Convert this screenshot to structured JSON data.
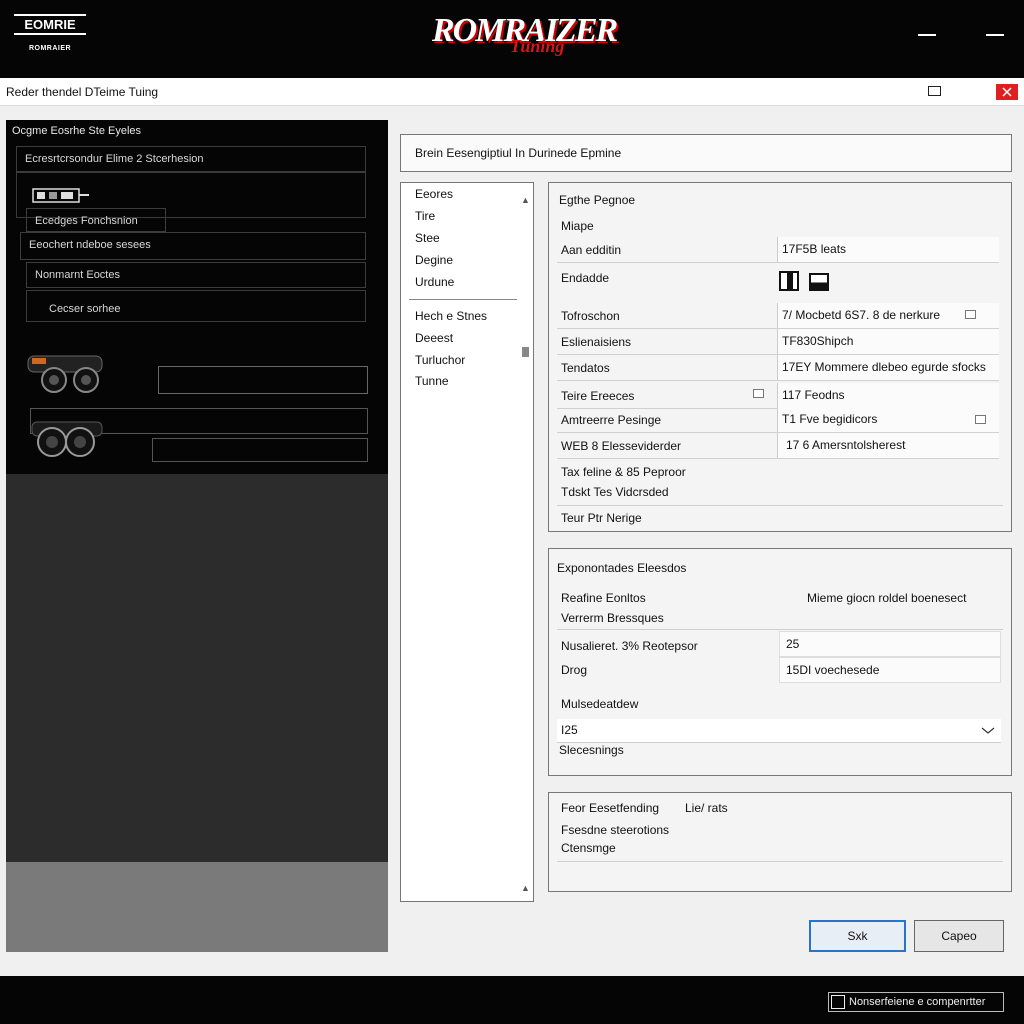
{
  "brand": {
    "left_logo_line1": "EOMRIE",
    "left_logo_line2": "ROMRAIER",
    "center_logo_main": "ROMRAIZER",
    "center_logo_sub": "Tuning"
  },
  "window": {
    "title": "Reder thendel DTeime Tuing"
  },
  "left_panel": {
    "heading": "Ocgme Eosrhe Ste Eyeles",
    "rows": [
      "Ecresrtcrsondur Elime 2 Stcerhesion",
      "Ecedges Fonchsnion",
      "Eeochert ndeboe sesees",
      "Nonmarnt Eoctes",
      "Cecser sorhee"
    ]
  },
  "breadcrumb": {
    "text": "Brein Eesengiptiul In Durinede Epmine"
  },
  "nav": {
    "group1": [
      "Eeores",
      "Tire",
      "Stee",
      "Degine",
      "Urdune"
    ],
    "group2": [
      "Hech e Stnes",
      "Deeest",
      "Turluchor",
      "Tunne"
    ]
  },
  "properties": {
    "header": "Egthe Pegnoe",
    "subheader": "Miape",
    "rows": [
      {
        "label": "Aan edditin",
        "value": "17F5B leats"
      },
      {
        "label": "Endadde",
        "value": ""
      },
      {
        "label": "Tofroschon",
        "value": "7/ Mocbetd 6S7. 8 de nerkure"
      },
      {
        "label": "Eslienaisiens",
        "value": "TF830Shipch"
      },
      {
        "label": "Tendatos",
        "value": "17EY Mommere dlebeo egurde sfocks"
      },
      {
        "label": "Teire Ereeces",
        "value": "117 Feodns"
      },
      {
        "label": "Amtreerre Pesinge",
        "value": "T1 Fve begidicors"
      },
      {
        "label": "WEB 8 Elesseviderder",
        "value": "17 6 Amersntolsherest"
      }
    ],
    "extra": [
      "Tax feline & 85 Peproor",
      "Tdskt Tes Vidcrsded",
      "Teur Ptr Nerige"
    ]
  },
  "exponentials": {
    "title": "Exponontades Eleesdos",
    "row1_left": "Reafine Eonltos",
    "row1_right": "Mieme giocn roldel boenesect",
    "row2_left": "Verrerm Bressques",
    "row3_label": "Nusalieret. 3% Reotepsor",
    "row3_value": "25",
    "row4_label": "Drog",
    "row4_value": "15DI voechesede",
    "row5_label": "Mulsedeatdew",
    "dropdown_value": "I25",
    "row6_label": "Slecesnings"
  },
  "small_panel": {
    "line1_left": "Feor Eesetfending",
    "line1_right": "Lie/ rats",
    "line2": "Fsesdne steerotions",
    "line3": "Ctensmge"
  },
  "buttons": {
    "ok": "Sxk",
    "cancel": "Capeo"
  },
  "status": {
    "text": "Nonserfeiene e compenrtter"
  }
}
